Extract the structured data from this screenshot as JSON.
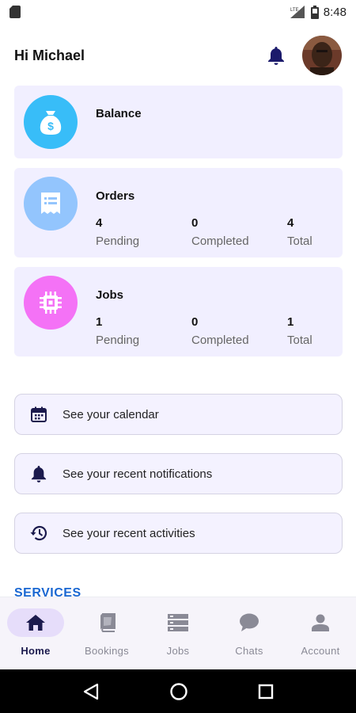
{
  "status_bar": {
    "time": "8:48"
  },
  "header": {
    "greeting": "Hi Michael"
  },
  "cards": {
    "balance": {
      "title": "Balance"
    },
    "orders": {
      "title": "Orders",
      "pending_value": "4",
      "pending_label": "Pending",
      "completed_value": "0",
      "completed_label": "Completed",
      "total_value": "4",
      "total_label": "Total"
    },
    "jobs": {
      "title": "Jobs",
      "pending_value": "1",
      "pending_label": "Pending",
      "completed_value": "0",
      "completed_label": "Completed",
      "total_value": "1",
      "total_label": "Total"
    }
  },
  "actions": {
    "calendar": "See your calendar",
    "notifications": "See your recent notifications",
    "activities": "See your recent activities"
  },
  "services_heading": "SERVICES",
  "bottom_nav": {
    "items": [
      {
        "label": "Home",
        "icon": "home-icon",
        "active": true
      },
      {
        "label": "Bookings",
        "icon": "book-icon",
        "active": false
      },
      {
        "label": "Jobs",
        "icon": "server-icon",
        "active": false
      },
      {
        "label": "Chats",
        "icon": "chat-icon",
        "active": false
      },
      {
        "label": "Account",
        "icon": "person-icon",
        "active": false
      }
    ]
  },
  "colors": {
    "card_bg": "#f1efff",
    "balance_icon": "#38bdf8",
    "orders_icon": "#93c5fd",
    "jobs_icon": "#f472f6",
    "accent_dark": "#1b1a4d",
    "services_blue": "#1967d2"
  }
}
